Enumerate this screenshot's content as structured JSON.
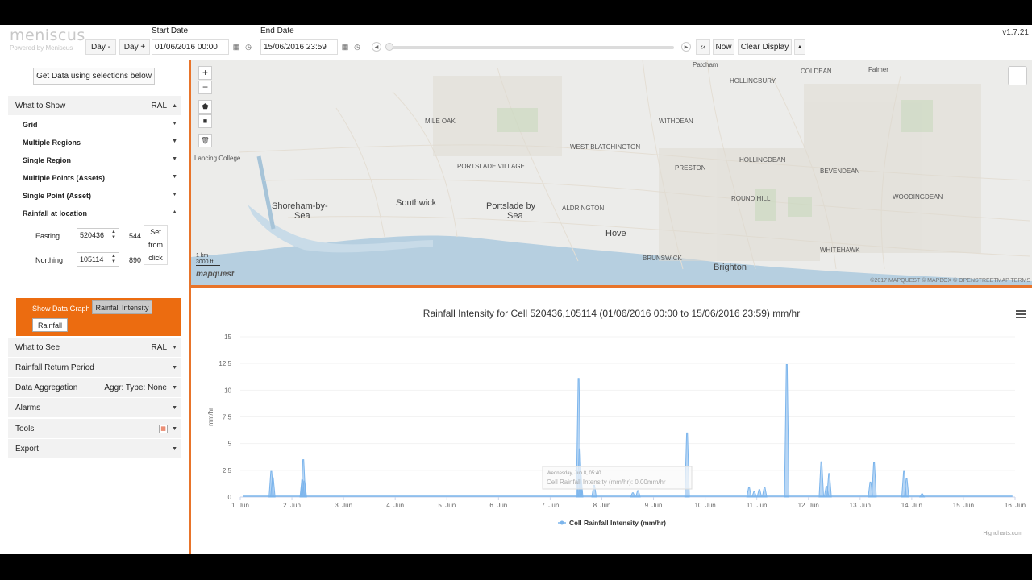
{
  "header": {
    "logo": "meniscus",
    "logo_sub": "Powered by Meniscus",
    "start_label": "Start Date",
    "end_label": "End Date",
    "day_minus": "Day -",
    "day_plus": "Day +",
    "start_date": "01/06/2016 00:00",
    "end_date": "15/06/2016 23:59",
    "rewind": "‹‹",
    "now": "Now",
    "clear_display": "Clear Display",
    "collapse": "▲",
    "version": "v1.7.21"
  },
  "sidebar": {
    "get_data": "Get Data using selections below",
    "what_to_show": "What to Show",
    "what_to_show_right": "RAL",
    "subitems": [
      "Grid",
      "Multiple Regions",
      "Single Region",
      "Multiple Points (Assets)",
      "Single Point (Asset)",
      "Rainfall at location"
    ],
    "easting_label": "Easting",
    "easting_value": "520436",
    "easting_extra": "544",
    "northing_label": "Northing",
    "northing_value": "105114",
    "northing_extra": "890",
    "set_from_click": [
      "Set",
      "from",
      "click"
    ],
    "show_graph": "Show Data Graph",
    "rainfall_intensity": "Rainfall Intensity",
    "rainfall": "Rainfall",
    "what_to_see": "What to See",
    "what_to_see_right": "RAL",
    "return_period": "Rainfall Return Period",
    "aggregation": "Data Aggregation",
    "aggregation_right": "Aggr:   Type: None",
    "alarms": "Alarms",
    "tools": "Tools",
    "export": "Export"
  },
  "map": {
    "zoom_in": "+",
    "zoom_out": "−",
    "labels": {
      "shoreham": "Shoreham-by-",
      "sea1": "Sea",
      "southwick": "Southwick",
      "portslade": "Portslade by",
      "sea2": "Sea",
      "hove": "Hove",
      "brighton": "Brighton",
      "hollingbury": "HOLLINGBURY",
      "coldean": "COLDEAN",
      "falmer": "Falmer",
      "withdean": "WITHDEAN",
      "preston": "PRESTON",
      "hollingdean": "HOLLINGDEAN",
      "bevendean": "BEVENDEAN",
      "woodingdean": "WOODINGDEAN",
      "whitehawk": "WHITEHAWK",
      "aldrington": "ALDRINGTON",
      "brunswick": "BRUNSWICK",
      "blatchington": "WEST BLATCHINGTON",
      "portslade_village": "PORTSLADE VILLAGE",
      "mile_oak": "MILE OAK",
      "round_hill": "ROUND HILL",
      "patcham": "Patcham",
      "lancing": "Lancing College"
    },
    "scale_km": "1 km",
    "scale_ft": "3000 ft",
    "mapquest": "mapquest",
    "attribution": "©2017 MAPQUEST  © MAPBOX  © OPENSTREETMAP  TERMS"
  },
  "chart_data": {
    "type": "area",
    "title": "Rainfall Intensity for Cell 520436,105114 (01/06/2016 00:00 to 15/06/2016 23:59) mm/hr",
    "ylabel": "mm/hr",
    "ylim": [
      0,
      15
    ],
    "yticks": [
      "0",
      "2.5",
      "5",
      "7.5",
      "10",
      "12.5",
      "15"
    ],
    "xticks": [
      "1. Jun",
      "2. Jun",
      "3. Jun",
      "4. Jun",
      "5. Jun",
      "6. Jun",
      "7. Jun",
      "8. Jun",
      "9. Jun",
      "10. Jun",
      "11. Jun",
      "12. Jun",
      "13. Jun",
      "14. Jun",
      "15. Jun",
      "16. Jun"
    ],
    "xlim": [
      1,
      16
    ],
    "series": [
      {
        "name": "Cell Rainfall Intensity (mm/hr)",
        "color": "#7cb5ec",
        "points": [
          [
            1.6,
            2.4
          ],
          [
            1.63,
            1.8
          ],
          [
            2.2,
            1.6
          ],
          [
            2.22,
            3.5
          ],
          [
            2.24,
            1.5
          ],
          [
            7.55,
            11.1
          ],
          [
            7.57,
            4.5
          ],
          [
            7.59,
            2.0
          ],
          [
            7.85,
            1.1
          ],
          [
            8.6,
            0.4
          ],
          [
            8.7,
            0.6
          ],
          [
            9.65,
            6.0
          ],
          [
            10.85,
            0.9
          ],
          [
            10.95,
            0.5
          ],
          [
            11.05,
            0.7
          ],
          [
            11.15,
            0.9
          ],
          [
            11.58,
            12.4
          ],
          [
            12.25,
            3.3
          ],
          [
            12.35,
            1.0
          ],
          [
            12.4,
            2.2
          ],
          [
            13.2,
            1.4
          ],
          [
            13.27,
            3.2
          ],
          [
            13.85,
            2.4
          ],
          [
            13.9,
            1.7
          ],
          [
            14.2,
            0.3
          ]
        ]
      }
    ],
    "tooltip": {
      "header": "Wednesday, Jun 8, 05:40",
      "line": "Cell Rainfall Intensity (mm/hr): 0.00mm/hr"
    },
    "legend": "Cell Rainfall Intensity (mm/hr)",
    "credit": "Highcharts.com"
  }
}
